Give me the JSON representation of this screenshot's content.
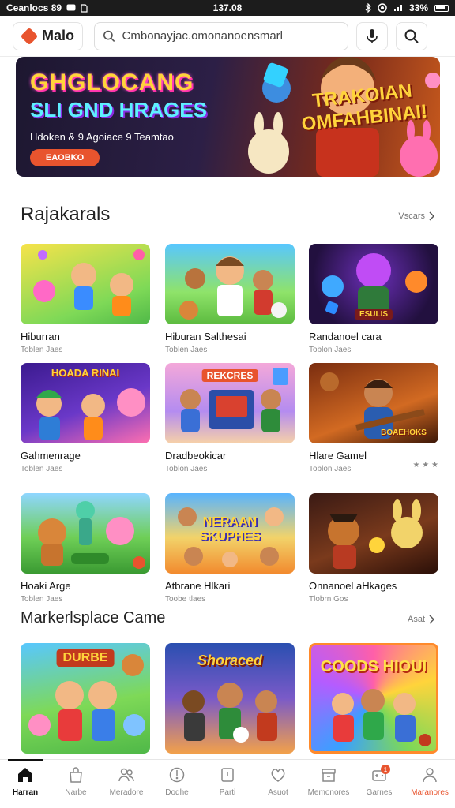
{
  "status_bar": {
    "carrier": "Ceanlocs 89",
    "time": "137.08",
    "battery": "33%"
  },
  "header": {
    "brand_name": "Malo",
    "search_value": "Cmbonayjac.omonanoensmarl"
  },
  "banner": {
    "title_line1": "GHGLOCANG",
    "title_line2": "SLI GND HRAGES",
    "subtitle": "Hdoken & 9 Agoiace 9 Teamtao",
    "cta_label": "EAOBKO",
    "promo_text": "TRAKOIAN OMFAHBINAI!"
  },
  "section1": {
    "title": "Rajakarals",
    "more_label": "Vscars",
    "cards": [
      {
        "title": "Hiburran",
        "subtitle": "Toblen Jaes",
        "thumb_text": ""
      },
      {
        "title": "Hiburan Salthesai",
        "subtitle": "Toblen Jaes",
        "thumb_text": ""
      },
      {
        "title": "Randanoel cara",
        "subtitle": "Toblon Jaes",
        "thumb_text": "ESULIS"
      },
      {
        "title": "Gahmenrage",
        "subtitle": "Toblen Jaes",
        "thumb_text": "HOADA RINAI"
      },
      {
        "title": "Dradbeokicar",
        "subtitle": "Toblon Jaes",
        "thumb_text": "REKCRES"
      },
      {
        "title": "Hlare Gamel",
        "subtitle": "Toblon Jaes",
        "thumb_text": "BOAEHOKS",
        "rating": "★ ★ ★"
      },
      {
        "title": "Hoaki Arge",
        "subtitle": "Toblen Jaes",
        "thumb_text": ""
      },
      {
        "title": "Atbrane Hlkari",
        "subtitle": "Toobe tlaes",
        "thumb_text": "NERAAN SKUPHES"
      },
      {
        "title": "Onnanoel aHkages",
        "subtitle": "Tlobrn Gos",
        "thumb_text": ""
      }
    ]
  },
  "section2": {
    "title": "Markerlsplace Came",
    "more_label": "Asat",
    "cards": [
      {
        "thumb_text": "DURBE"
      },
      {
        "thumb_text": "Shoraced"
      },
      {
        "thumb_text": "COODS HIOUI"
      }
    ]
  },
  "bottom_nav": [
    {
      "label": "Harran",
      "icon": "home-icon"
    },
    {
      "label": "Narbe",
      "icon": "bag-icon"
    },
    {
      "label": "Meradore",
      "icon": "people-icon"
    },
    {
      "label": "Dodhe",
      "icon": "compass-icon"
    },
    {
      "label": "Parti",
      "icon": "book-icon"
    },
    {
      "label": "Asuot",
      "icon": "heart-icon"
    },
    {
      "label": "Memonores",
      "icon": "archive-icon"
    },
    {
      "label": "Garnes",
      "icon": "game-icon",
      "badge": "1"
    },
    {
      "label": "Maranores",
      "icon": "user-icon"
    }
  ]
}
